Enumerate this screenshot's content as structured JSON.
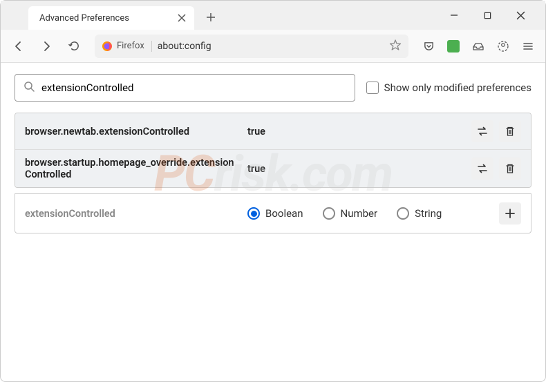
{
  "window": {
    "tab_title": "Advanced Preferences"
  },
  "urlbar": {
    "identity_label": "Firefox",
    "url": "about:config"
  },
  "search": {
    "value": "extensionControlled",
    "checkbox_label": "Show only modified preferences"
  },
  "prefs": [
    {
      "name": "browser.newtab.extensionControlled",
      "value": "true"
    },
    {
      "name": "browser.startup.homepage_override.extensionControlled",
      "value": "true"
    }
  ],
  "new_pref": {
    "name": "extensionControlled",
    "types": [
      "Boolean",
      "Number",
      "String"
    ],
    "selected": "Boolean"
  },
  "watermark": {
    "pc": "PC",
    "rest": "risk.com"
  }
}
